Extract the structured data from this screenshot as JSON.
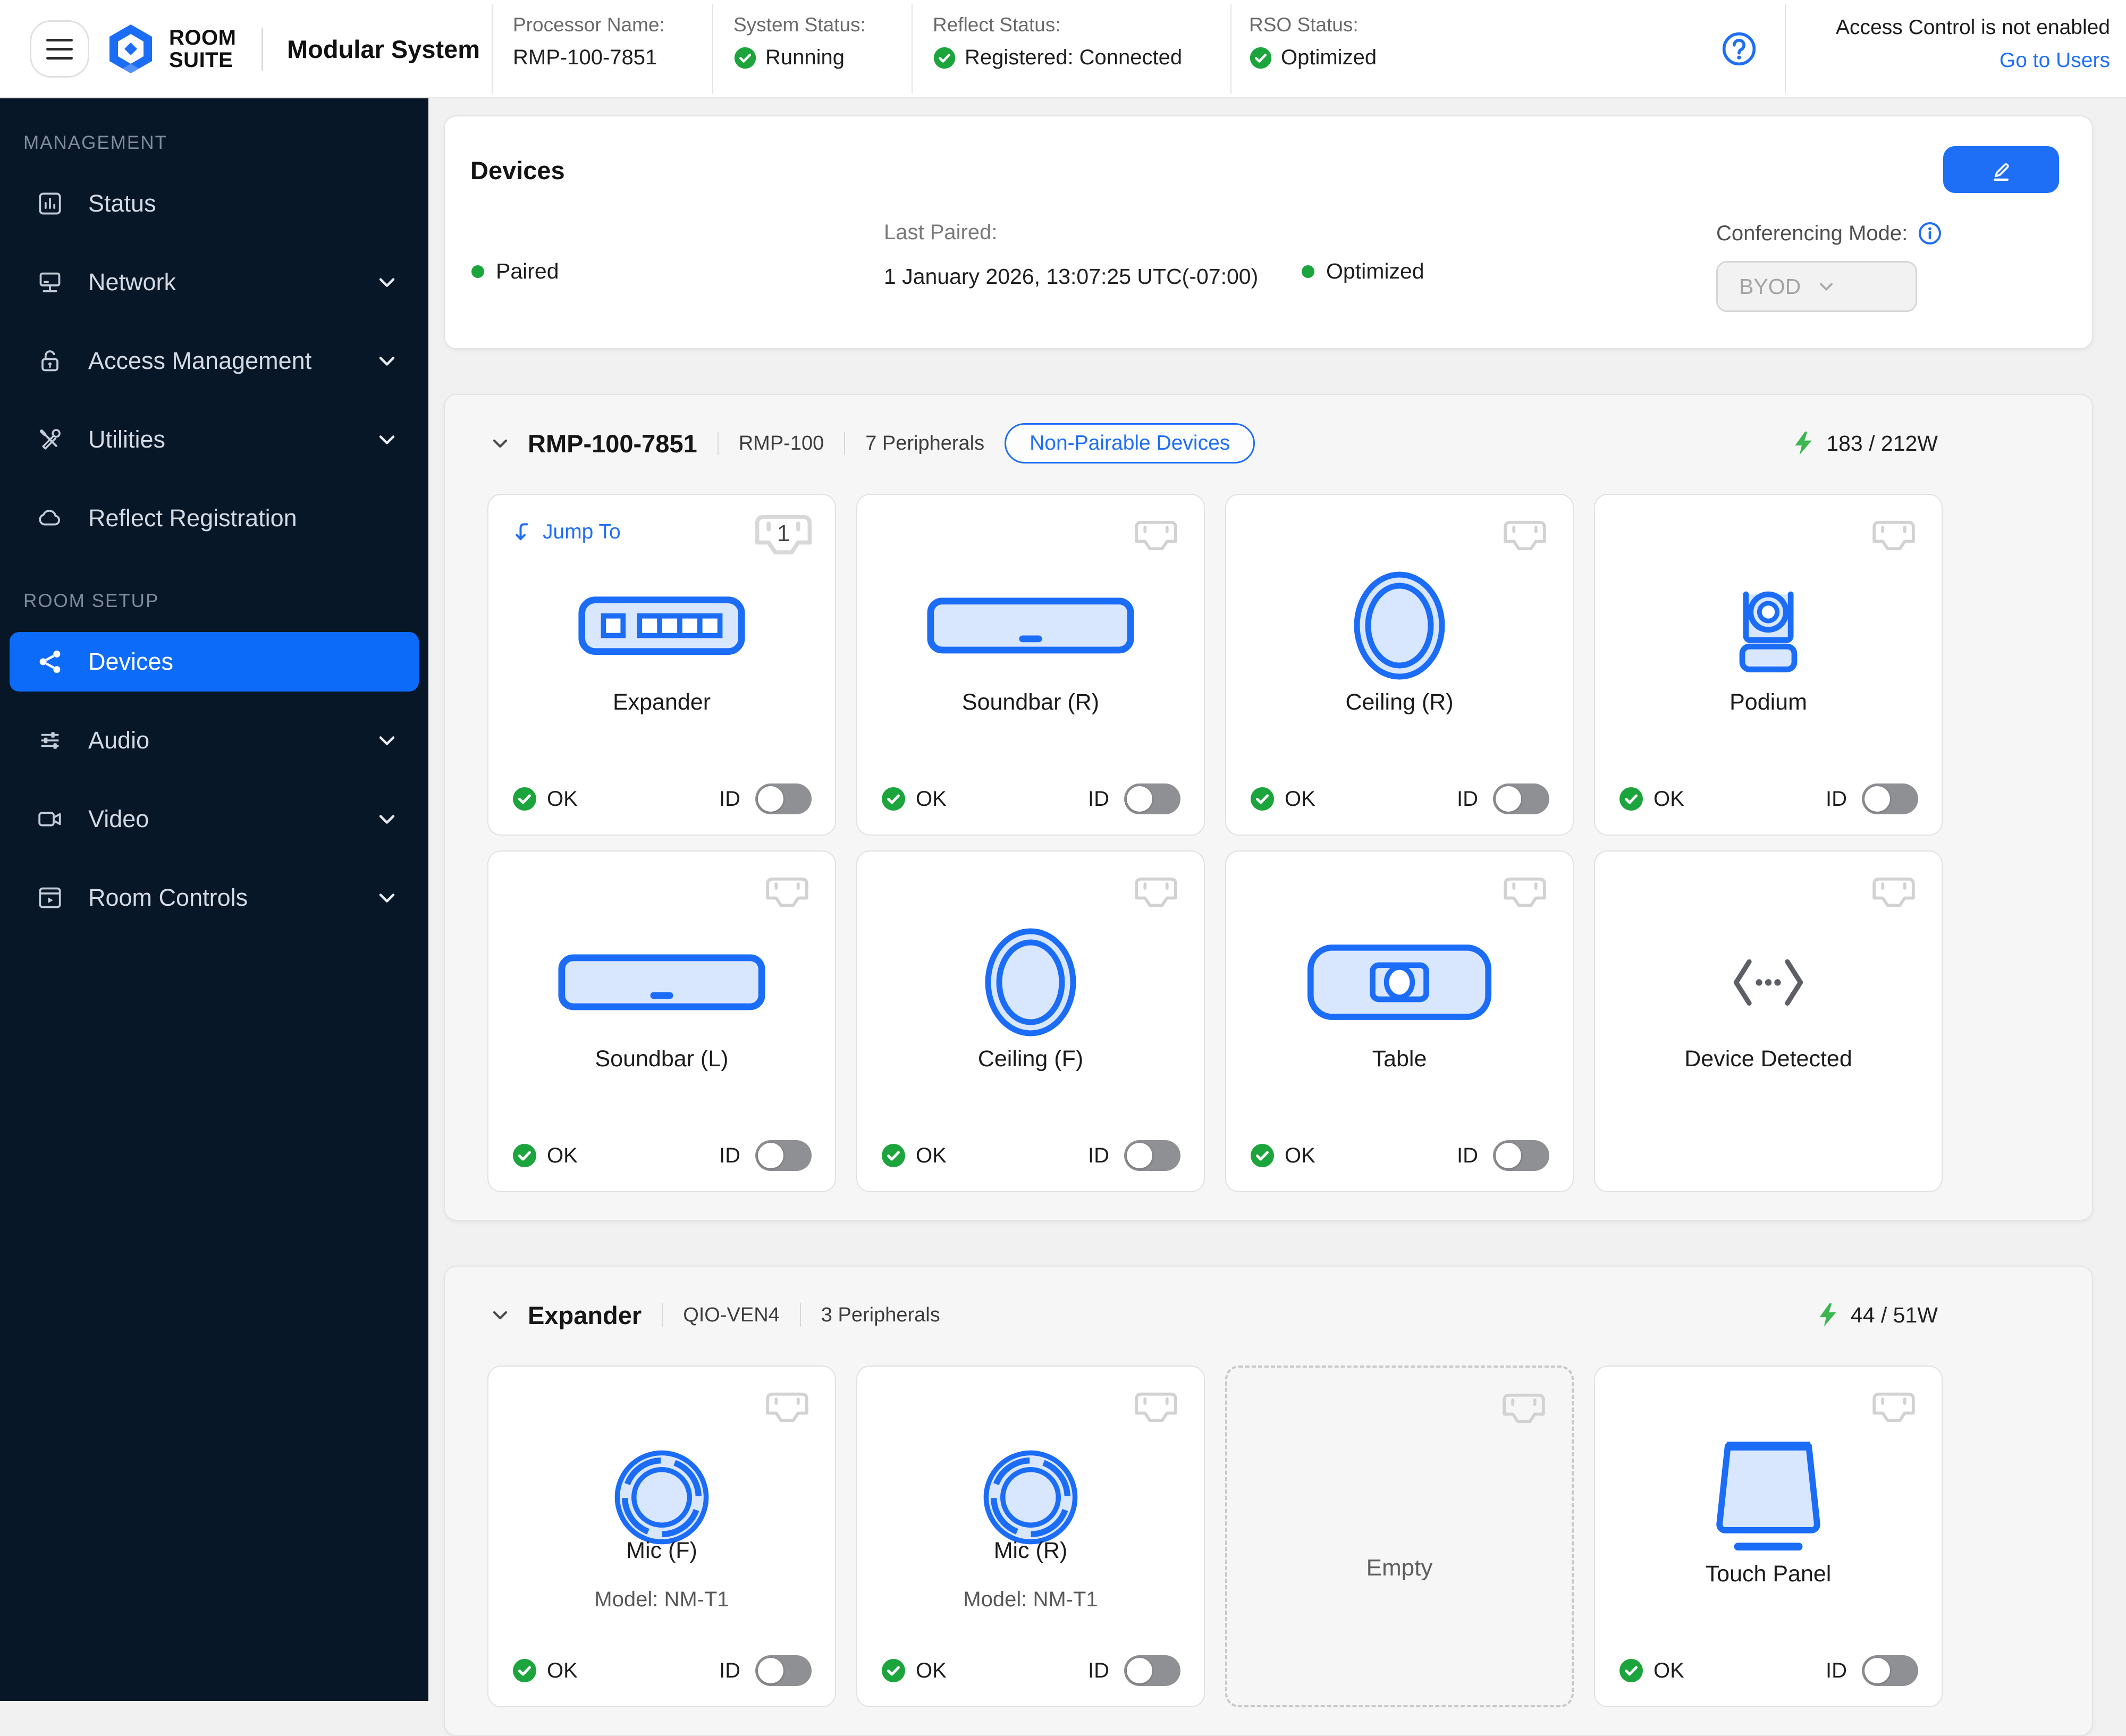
{
  "colors": {
    "accent_blue": "#1f6ef6",
    "device_icon_blue": "#1b6cf7",
    "device_icon_fill": "#d9e7fe",
    "status_green": "#1ca43d",
    "bolt_green": "#3cb64e",
    "sidebar_bg": "#081727",
    "sidebar_active": "#0d6bfa",
    "page_bg": "#f1f1f2",
    "group_panel_bg": "#f6f6f7",
    "toggle_off": "#8f9094"
  },
  "header": {
    "brand_line1": "ROOM",
    "brand_line2": "SUITE",
    "app_title": "Modular System",
    "fields": [
      {
        "label": "Processor Name:",
        "value": "RMP-100-7851",
        "check": false
      },
      {
        "label": "System Status:",
        "value": "Running",
        "check": true
      },
      {
        "label": "Reflect Status:",
        "value": "Registered: Connected",
        "check": true
      },
      {
        "label": "RSO Status:",
        "value": "Optimized",
        "check": true
      }
    ],
    "help_glyph": "?",
    "access_note": "Access Control is not enabled",
    "go_to_users": "Go to Users"
  },
  "sidebar": {
    "sections": [
      {
        "label": "MANAGEMENT",
        "items": [
          {
            "label": "Status"
          },
          {
            "label": "Network"
          },
          {
            "label": "Access Management"
          },
          {
            "label": "Utilities"
          },
          {
            "label": "Reflect Registration"
          }
        ]
      },
      {
        "label": "ROOM SETUP",
        "items": [
          {
            "label": "Devices"
          },
          {
            "label": "Audio"
          },
          {
            "label": "Video"
          },
          {
            "label": "Room Controls"
          }
        ]
      }
    ]
  },
  "devices_panel": {
    "title": "Devices",
    "paired_label": "Paired",
    "last_paired_label": "Last Paired:",
    "last_paired_value": "1 January 2026, 13:07:25 UTC(-07:00)",
    "optimized_label": "Optimized",
    "conferencing_mode_label": "Conferencing Mode:",
    "conferencing_mode_value": "BYOD"
  },
  "groups": [
    {
      "title": "RMP-100-7851",
      "model": "RMP-100",
      "peripherals": "7 Peripherals",
      "pill_label": "Non-Pairable Devices",
      "power": "183 / 212W",
      "cards": [
        {
          "name": "Expander",
          "jump_label": "Jump To",
          "port_number": "1",
          "status": "OK",
          "id_label": "ID"
        },
        {
          "name": "Soundbar (R)",
          "status": "OK",
          "id_label": "ID"
        },
        {
          "name": "Ceiling (R)",
          "status": "OK",
          "id_label": "ID"
        },
        {
          "name": "Podium",
          "status": "OK",
          "id_label": "ID"
        },
        {
          "name": "Soundbar (L)",
          "status": "OK",
          "id_label": "ID"
        },
        {
          "name": "Ceiling (F)",
          "status": "OK",
          "id_label": "ID"
        },
        {
          "name": "Table",
          "status": "OK",
          "id_label": "ID"
        },
        {
          "name": "Device Detected"
        }
      ]
    },
    {
      "title": "Expander",
      "model": "QIO-VEN4",
      "peripherals": "3 Peripherals",
      "power": "44 / 51W",
      "cards": [
        {
          "name": "Mic (F)",
          "model_label": "Model: NM-T1",
          "status": "OK",
          "id_label": "ID"
        },
        {
          "name": "Mic (R)",
          "model_label": "Model: NM-T1",
          "status": "OK",
          "id_label": "ID"
        },
        {
          "empty_label": "Empty"
        },
        {
          "name": "Touch Panel",
          "status": "OK",
          "id_label": "ID"
        }
      ]
    }
  ]
}
